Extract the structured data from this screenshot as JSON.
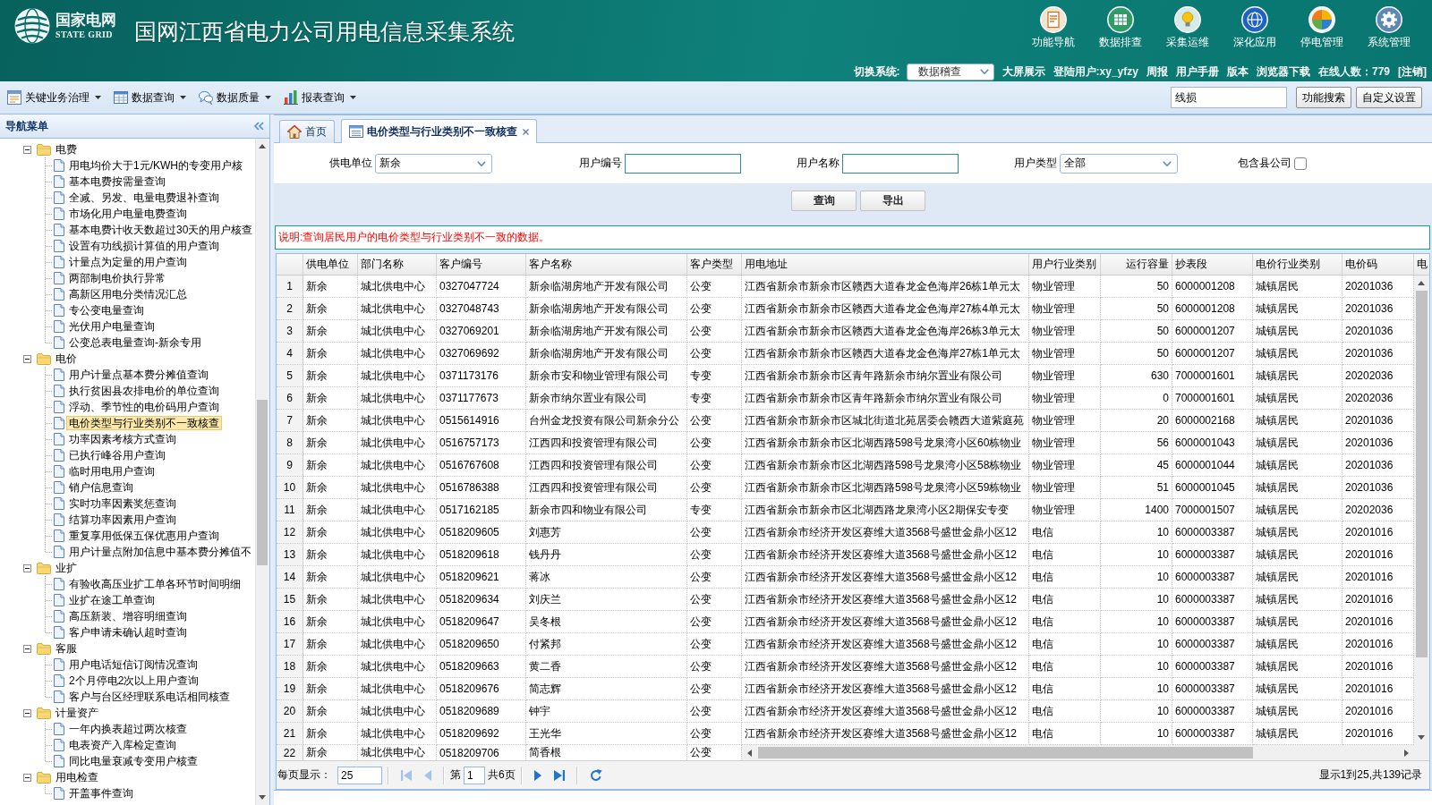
{
  "header": {
    "logo": {
      "name": "国家电网",
      "name_en": "STATE GRID"
    },
    "title": "国网江西省电力公司用电信息采集系统",
    "nav": [
      {
        "label": "功能导航"
      },
      {
        "label": "数据排查"
      },
      {
        "label": "采集运维"
      },
      {
        "label": "深化应用"
      },
      {
        "label": "停电管理"
      },
      {
        "label": "系统管理"
      }
    ],
    "user_bar": {
      "switch_label": "切换系统:",
      "system": "数据稽查",
      "items": [
        {
          "text": "大屏展示",
          "kind": "link"
        },
        {
          "text": "登陆用户:xy_yfzy",
          "kind": "info"
        },
        {
          "text": "周报",
          "kind": "link"
        },
        {
          "text": "用户手册",
          "kind": "link"
        },
        {
          "text": "版本",
          "kind": "link"
        },
        {
          "text": "浏览器下载",
          "kind": "link"
        },
        {
          "text": "在线人数：779",
          "kind": "info"
        },
        {
          "text": "[注销]",
          "kind": "link"
        }
      ]
    }
  },
  "toolbar": {
    "menus": [
      {
        "label": "关键业务治理"
      },
      {
        "label": "数据查询"
      },
      {
        "label": "数据质量"
      },
      {
        "label": "报表查询"
      }
    ],
    "search": {
      "value": "线损"
    },
    "buttons": [
      "功能搜索",
      "自定义设置"
    ]
  },
  "sidebar": {
    "title": "导航菜单",
    "tree": [
      {
        "label": "电费",
        "expanded": true,
        "selected": false,
        "children": [
          {
            "label": "用电均价大于1元/KWH的专变用户核",
            "selected": false
          },
          {
            "label": "基本电费按需量查询",
            "selected": false
          },
          {
            "label": "全减、另发、电量电费退补查询",
            "selected": false
          },
          {
            "label": "市场化用户电量电费查询",
            "selected": false
          },
          {
            "label": "基本电费计收天数超过30天的用户核查",
            "selected": false
          },
          {
            "label": "设置有功线损计算值的用户查询",
            "selected": false
          },
          {
            "label": "计量点为定量的用户查询",
            "selected": false
          },
          {
            "label": "两部制电价执行异常",
            "selected": false
          },
          {
            "label": "高新区用电分类情况汇总",
            "selected": false
          },
          {
            "label": "专公变电量查询",
            "selected": false
          },
          {
            "label": "光伏用户电量查询",
            "selected": false
          },
          {
            "label": "公变总表电量查询-新余专用",
            "selected": false
          }
        ]
      },
      {
        "label": "电价",
        "expanded": true,
        "selected": false,
        "children": [
          {
            "label": "用户计量点基本费分摊值查询",
            "selected": false
          },
          {
            "label": "执行贫困县农排电价的单位查询",
            "selected": false
          },
          {
            "label": "浮动、季节性的电价码用户查询",
            "selected": false
          },
          {
            "label": "电价类型与行业类别不一致核查",
            "selected": true
          },
          {
            "label": "功率因素考核方式查询",
            "selected": false
          },
          {
            "label": "已执行峰谷用户查询",
            "selected": false
          },
          {
            "label": "临时用电用户查询",
            "selected": false
          },
          {
            "label": "销户信息查询",
            "selected": false
          },
          {
            "label": "实时功率因素奖惩查询",
            "selected": false
          },
          {
            "label": "结算功率因素用户查询",
            "selected": false
          },
          {
            "label": "重复享用低保五保优惠用户查询",
            "selected": false
          },
          {
            "label": "用户计量点附加信息中基本费分摊值不",
            "selected": false
          }
        ]
      },
      {
        "label": "业扩",
        "expanded": true,
        "selected": false,
        "children": [
          {
            "label": "有验收高压业扩工单各环节时间明细",
            "selected": false
          },
          {
            "label": "业扩在途工单查询",
            "selected": false
          },
          {
            "label": "高压新装、增容明细查询",
            "selected": false
          },
          {
            "label": "客户申请未确认超时查询",
            "selected": false
          }
        ]
      },
      {
        "label": "客服",
        "expanded": true,
        "selected": false,
        "children": [
          {
            "label": "用户电话短信订阅情况查询",
            "selected": false
          },
          {
            "label": "2个月停电2次以上用户查询",
            "selected": false
          },
          {
            "label": "客户与台区经理联系电话相同核查",
            "selected": false
          }
        ]
      },
      {
        "label": "计量资产",
        "expanded": true,
        "selected": false,
        "children": [
          {
            "label": "一年内换表超过两次核查",
            "selected": false
          },
          {
            "label": "电表资产入库检定查询",
            "selected": false
          },
          {
            "label": "同比电量衰减专变用户核查",
            "selected": false
          }
        ]
      },
      {
        "label": "用电检查",
        "expanded": true,
        "selected": false,
        "children": [
          {
            "label": "开盖事件查询",
            "selected": false
          }
        ]
      }
    ]
  },
  "tabs": [
    {
      "label": "首页",
      "kind": "home",
      "selected": false,
      "closable": false
    },
    {
      "label": "电价类型与行业类别不一致核查",
      "kind": "page",
      "selected": true,
      "closable": true
    }
  ],
  "filters": [
    {
      "kind": "select",
      "label": "供电单位",
      "value": "新余"
    },
    {
      "kind": "input",
      "label": "用户编号"
    },
    {
      "kind": "input",
      "label": "用户名称"
    },
    {
      "kind": "select",
      "label": "用户类型",
      "value": "全部"
    },
    {
      "kind": "checkbox",
      "label": "包含县公司",
      "checked": false
    }
  ],
  "actions": [
    "查询",
    "导出"
  ],
  "note": "说明:查询居民用户的电价类型与行业类别不一致的数据。",
  "table": {
    "columns": [
      {
        "label": "供电单位",
        "kind": "text"
      },
      {
        "label": "部门名称",
        "kind": "text"
      },
      {
        "label": "客户编号",
        "kind": "text"
      },
      {
        "label": "客户名称",
        "kind": "text"
      },
      {
        "label": "客户类型",
        "kind": "text"
      },
      {
        "label": "用电地址",
        "kind": "text"
      },
      {
        "label": "用户行业类别",
        "kind": "text"
      },
      {
        "label": "运行容量",
        "kind": "number"
      },
      {
        "label": "抄表段",
        "kind": "text"
      },
      {
        "label": "电价行业类别",
        "kind": "text"
      },
      {
        "label": "电价码",
        "kind": "text"
      },
      {
        "label": "电",
        "kind": "text"
      }
    ],
    "rows": [
      {
        "number": "1",
        "cells": [
          "新余",
          "城北供电中心",
          "0327047724",
          "新余临湖房地产开发有限公司",
          "公变",
          "江西省新余市新余市区赣西大道春龙金色海岸26栋1单元太",
          "物业管理",
          "50",
          "6000001208",
          "城镇居民",
          "20201036"
        ]
      },
      {
        "number": "2",
        "cells": [
          "新余",
          "城北供电中心",
          "0327048743",
          "新余临湖房地产开发有限公司",
          "公变",
          "江西省新余市新余市区赣西大道春龙金色海岸27栋4单元太",
          "物业管理",
          "50",
          "6000001208",
          "城镇居民",
          "20201036"
        ]
      },
      {
        "number": "3",
        "cells": [
          "新余",
          "城北供电中心",
          "0327069201",
          "新余临湖房地产开发有限公司",
          "公变",
          "江西省新余市新余市区赣西大道春龙金色海岸26栋3单元太",
          "物业管理",
          "50",
          "6000001207",
          "城镇居民",
          "20201036"
        ]
      },
      {
        "number": "4",
        "cells": [
          "新余",
          "城北供电中心",
          "0327069692",
          "新余临湖房地产开发有限公司",
          "公变",
          "江西省新余市新余市区赣西大道春龙金色海岸27栋1单元太",
          "物业管理",
          "50",
          "6000001207",
          "城镇居民",
          "20201036"
        ]
      },
      {
        "number": "5",
        "cells": [
          "新余",
          "城北供电中心",
          "0371173176",
          "新余市安和物业管理有限公司",
          "专变",
          "江西省新余市新余市区青年路新余市纳尔置业有限公司",
          "物业管理",
          "630",
          "7000001601",
          "城镇居民",
          "20202036"
        ]
      },
      {
        "number": "6",
        "cells": [
          "新余",
          "城北供电中心",
          "0371177673",
          "新余市纳尔置业有限公司",
          "专变",
          "江西省新余市新余市区青年路新余市纳尔置业有限公司",
          "物业管理",
          "0",
          "7000001601",
          "城镇居民",
          "20202036"
        ]
      },
      {
        "number": "7",
        "cells": [
          "新余",
          "城北供电中心",
          "0515614916",
          "台州金龙投资有限公司新余分公",
          "公变",
          "江西省新余市新余市区城北街道北苑居委会赣西大道紫庭苑",
          "物业管理",
          "20",
          "6000002168",
          "城镇居民",
          "20201036"
        ]
      },
      {
        "number": "8",
        "cells": [
          "新余",
          "城北供电中心",
          "0516757173",
          "江西四和投资管理有限公司",
          "公变",
          "江西省新余市新余市区北湖西路598号龙泉湾小区60栋物业",
          "物业管理",
          "56",
          "6000001043",
          "城镇居民",
          "20201036"
        ]
      },
      {
        "number": "9",
        "cells": [
          "新余",
          "城北供电中心",
          "0516767608",
          "江西四和投资管理有限公司",
          "公变",
          "江西省新余市新余市区北湖西路598号龙泉湾小区58栋物业",
          "物业管理",
          "45",
          "6000001044",
          "城镇居民",
          "20201036"
        ]
      },
      {
        "number": "10",
        "cells": [
          "新余",
          "城北供电中心",
          "0516786388",
          "江西四和投资管理有限公司",
          "公变",
          "江西省新余市新余市区北湖西路598号龙泉湾小区59栋物业",
          "物业管理",
          "51",
          "6000001045",
          "城镇居民",
          "20201036"
        ]
      },
      {
        "number": "11",
        "cells": [
          "新余",
          "城北供电中心",
          "0517162185",
          "新余市四和物业有限公司",
          "专变",
          "江西省新余市新余市区北湖西路龙泉湾小区2期保安专变",
          "物业管理",
          "1400",
          "7000001507",
          "城镇居民",
          "20202036"
        ]
      },
      {
        "number": "12",
        "cells": [
          "新余",
          "城北供电中心",
          "0518209605",
          "刘惠芳",
          "公变",
          "江西省新余市经济开发区赛维大道3568号盛世金鼎小区12",
          "电信",
          "10",
          "6000003387",
          "城镇居民",
          "20201016"
        ]
      },
      {
        "number": "13",
        "cells": [
          "新余",
          "城北供电中心",
          "0518209618",
          "钱丹丹",
          "公变",
          "江西省新余市经济开发区赛维大道3568号盛世金鼎小区12",
          "电信",
          "10",
          "6000003387",
          "城镇居民",
          "20201016"
        ]
      },
      {
        "number": "14",
        "cells": [
          "新余",
          "城北供电中心",
          "0518209621",
          "蒋冰",
          "公变",
          "江西省新余市经济开发区赛维大道3568号盛世金鼎小区12",
          "电信",
          "10",
          "6000003387",
          "城镇居民",
          "20201016"
        ]
      },
      {
        "number": "15",
        "cells": [
          "新余",
          "城北供电中心",
          "0518209634",
          "刘庆兰",
          "公变",
          "江西省新余市经济开发区赛维大道3568号盛世金鼎小区12",
          "电信",
          "10",
          "6000003387",
          "城镇居民",
          "20201016"
        ]
      },
      {
        "number": "16",
        "cells": [
          "新余",
          "城北供电中心",
          "0518209647",
          "吴冬根",
          "公变",
          "江西省新余市经济开发区赛维大道3568号盛世金鼎小区12",
          "电信",
          "10",
          "6000003387",
          "城镇居民",
          "20201016"
        ]
      },
      {
        "number": "17",
        "cells": [
          "新余",
          "城北供电中心",
          "0518209650",
          "付紧邦",
          "公变",
          "江西省新余市经济开发区赛维大道3568号盛世金鼎小区12",
          "电信",
          "10",
          "6000003387",
          "城镇居民",
          "20201016"
        ]
      },
      {
        "number": "18",
        "cells": [
          "新余",
          "城北供电中心",
          "0518209663",
          "黄二香",
          "公变",
          "江西省新余市经济开发区赛维大道3568号盛世金鼎小区12",
          "电信",
          "10",
          "6000003387",
          "城镇居民",
          "20201016"
        ]
      },
      {
        "number": "19",
        "cells": [
          "新余",
          "城北供电中心",
          "0518209676",
          "简志辉",
          "公变",
          "江西省新余市经济开发区赛维大道3568号盛世金鼎小区12",
          "电信",
          "10",
          "6000003387",
          "城镇居民",
          "20201016"
        ]
      },
      {
        "number": "20",
        "cells": [
          "新余",
          "城北供电中心",
          "0518209689",
          "钟宇",
          "公变",
          "江西省新余市经济开发区赛维大道3568号盛世金鼎小区12",
          "电信",
          "10",
          "6000003387",
          "城镇居民",
          "20201016"
        ]
      },
      {
        "number": "21",
        "cells": [
          "新余",
          "城北供电中心",
          "0518209692",
          "王光华",
          "公变",
          "江西省新余市经济开发区赛维大道3568号盛世金鼎小区12",
          "电信",
          "10",
          "6000003387",
          "城镇居民",
          "20201016"
        ]
      },
      {
        "number": "22",
        "cells": [
          "新余",
          "城北供电中心",
          "0518209706",
          "简香根",
          "公变"
        ]
      }
    ]
  },
  "pager": {
    "page_size_label": "每页显示：",
    "page_size": "25",
    "page_label": "第",
    "page": "1",
    "page_count": "共6页",
    "buttons": [
      {
        "kind": "first",
        "disabled": true
      },
      {
        "kind": "prev",
        "disabled": true
      },
      {
        "kind": "next",
        "disabled": false
      },
      {
        "kind": "last",
        "disabled": false
      },
      {
        "kind": "refresh",
        "disabled": false
      }
    ],
    "summary": "显示1到25,共139记录"
  }
}
